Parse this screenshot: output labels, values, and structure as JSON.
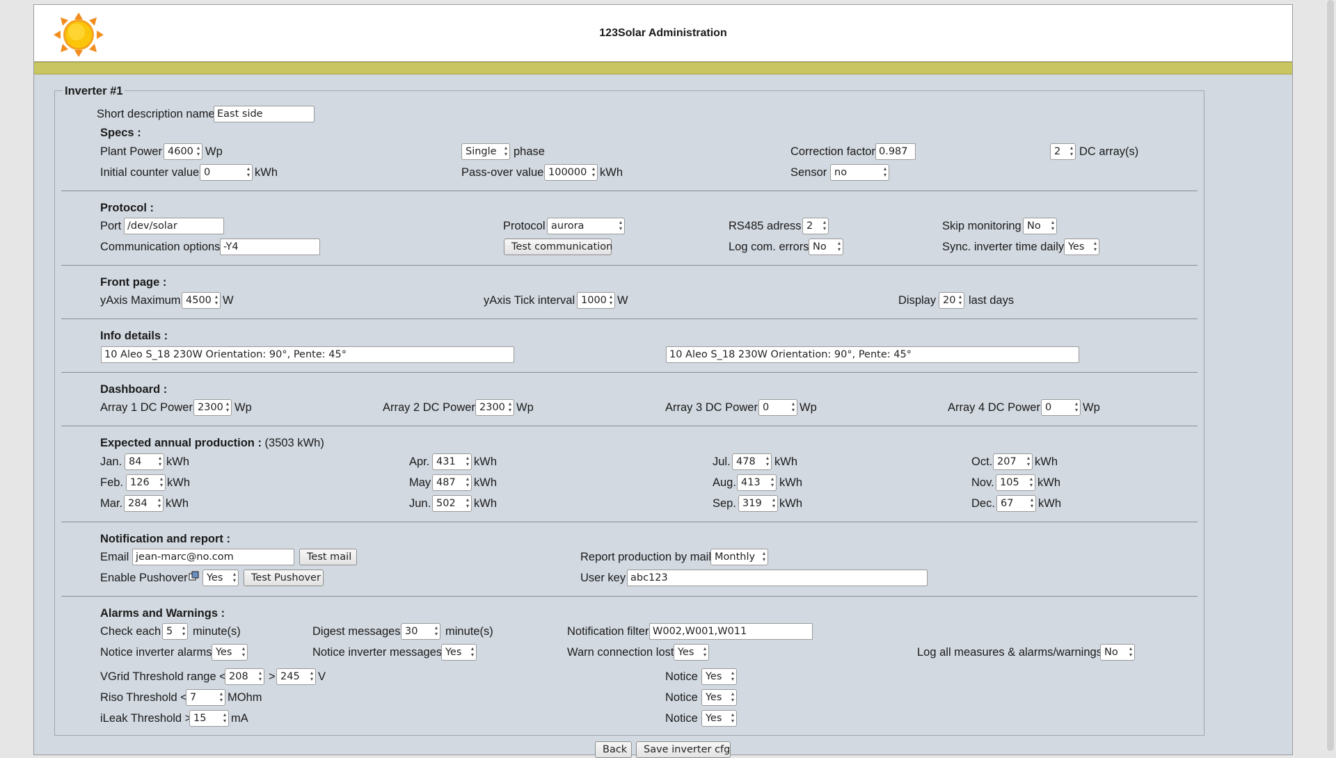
{
  "header": {
    "title": "123Solar Administration"
  },
  "legend": "Inverter #1",
  "short_desc": {
    "label": "Short description name",
    "value": "East side"
  },
  "specs": {
    "heading": "Specs :",
    "plant_power": {
      "label": "Plant Power",
      "value": "4600",
      "unit": "Wp"
    },
    "phase": {
      "value": "Single",
      "label": "phase"
    },
    "correction": {
      "label": "Correction factor",
      "value": "0.987"
    },
    "dc_arrays": {
      "value": "2",
      "label": "DC array(s)"
    },
    "initial_counter": {
      "label": "Initial counter value",
      "value": "0",
      "unit": "kWh"
    },
    "passover": {
      "label": "Pass-over value",
      "value": "100000",
      "unit": "kWh"
    },
    "sensor": {
      "label": "Sensor",
      "value": "no"
    }
  },
  "protocol": {
    "heading": "Protocol :",
    "port": {
      "label": "Port",
      "value": "/dev/solar"
    },
    "protocol": {
      "label": "Protocol",
      "value": "aurora"
    },
    "rs485": {
      "label": "RS485 adress",
      "value": "2"
    },
    "skip": {
      "label": "Skip monitoring",
      "value": "No"
    },
    "comm_options": {
      "label": "Communication options",
      "value": "-Y4"
    },
    "test_comm": "Test communication",
    "log_errors": {
      "label": "Log com. errors",
      "value": "No"
    },
    "sync_time": {
      "label": "Sync. inverter time daily",
      "value": "Yes"
    }
  },
  "front": {
    "heading": "Front page :",
    "yaxis_max": {
      "label": "yAxis Maximum",
      "value": "4500",
      "unit": "W"
    },
    "yaxis_tick": {
      "label": "yAxis Tick interval",
      "value": "1000",
      "unit": "W"
    },
    "display": {
      "label": "Display",
      "value": "20",
      "unit": "last days"
    }
  },
  "info": {
    "heading": "Info details :",
    "left": "10 Aleo S_18 230W Orientation: 90°, Pente: 45°",
    "right": "10 Aleo S_18 230W Orientation: 90°, Pente: 45°"
  },
  "dashboard": {
    "heading": "Dashboard :",
    "arrays": [
      {
        "label": "Array 1 DC Power",
        "value": "2300",
        "unit": "Wp"
      },
      {
        "label": "Array 2 DC Power",
        "value": "2300",
        "unit": "Wp"
      },
      {
        "label": "Array 3 DC Power",
        "value": "0",
        "unit": "Wp"
      },
      {
        "label": "Array 4 DC Power",
        "value": "0",
        "unit": "Wp"
      }
    ]
  },
  "expected": {
    "heading": "Expected annual production :",
    "total": "(3503 kWh)",
    "unit": "kWh",
    "months": [
      {
        "label": "Jan.",
        "value": "84"
      },
      {
        "label": "Feb.",
        "value": "126"
      },
      {
        "label": "Mar.",
        "value": "284"
      },
      {
        "label": "Apr.",
        "value": "431"
      },
      {
        "label": "May",
        "value": "487"
      },
      {
        "label": "Jun.",
        "value": "502"
      },
      {
        "label": "Jul.",
        "value": "478"
      },
      {
        "label": "Aug.",
        "value": "413"
      },
      {
        "label": "Sep.",
        "value": "319"
      },
      {
        "label": "Oct.",
        "value": "207"
      },
      {
        "label": "Nov.",
        "value": "105"
      },
      {
        "label": "Dec.",
        "value": "67"
      }
    ]
  },
  "notification": {
    "heading": "Notification and report :",
    "email": {
      "label": "Email",
      "value": "jean-marc@no.com"
    },
    "test_mail": "Test mail",
    "report": {
      "label": "Report production by mail",
      "value": "Monthly"
    },
    "pushover": {
      "label": "Enable Pushover",
      "value": "Yes"
    },
    "test_pushover": "Test Pushover",
    "user_key": {
      "label": "User key",
      "value": "abc123"
    }
  },
  "alarms": {
    "heading": "Alarms and Warnings :",
    "check_each": {
      "label": "Check each",
      "value": "5",
      "unit": "minute(s)"
    },
    "digest": {
      "label": "Digest messages",
      "value": "30",
      "unit": "minute(s)"
    },
    "notif_filter": {
      "label": "Notification filter",
      "value": "W002,W001,W011"
    },
    "notice_alarms": {
      "label": "Notice inverter alarms",
      "value": "Yes"
    },
    "notice_messages": {
      "label": "Notice inverter messages",
      "value": "Yes"
    },
    "warn_lost": {
      "label": "Warn connection lost",
      "value": "Yes"
    },
    "log_all": {
      "label": "Log all measures & alarms/warnings",
      "value": "No"
    },
    "vgrid": {
      "label": "VGrid Threshold range <",
      "low": "208",
      "sep": ">",
      "high": "245",
      "unit": "V"
    },
    "riso": {
      "label": "Riso Threshold <",
      "value": "7",
      "unit": "MOhm"
    },
    "ileak": {
      "label": "iLeak Threshold >",
      "value": "15",
      "unit": "mA"
    },
    "notice_label": "Notice",
    "notice_vgrid": "Yes",
    "notice_riso": "Yes",
    "notice_ileak": "Yes"
  },
  "buttons": {
    "back": "Back",
    "save": "Save inverter cfg"
  }
}
